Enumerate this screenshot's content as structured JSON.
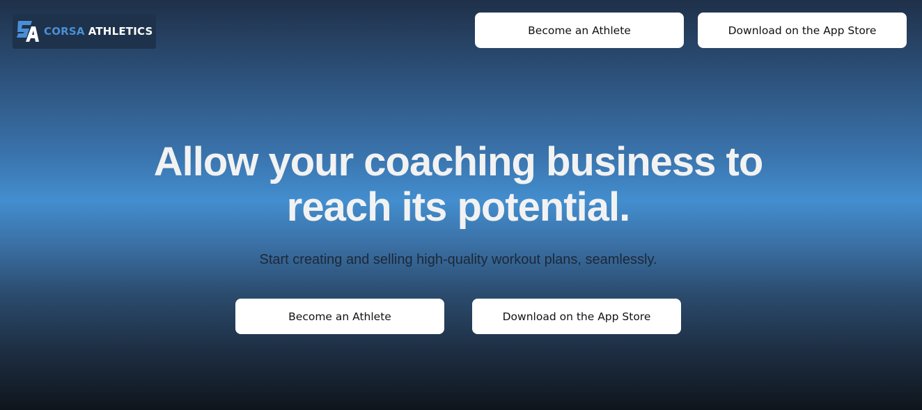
{
  "brand": {
    "word1": "CORSA",
    "word2": "ATHLETICS",
    "icon": "corsa-athletics-logo-icon",
    "colors": {
      "primary": "#4a8fd6",
      "secondary": "#ffffff",
      "badge_bg": "#1e324b"
    }
  },
  "nav": {
    "become_athlete_label": "Become an Athlete",
    "app_store_label": "Download on the App Store"
  },
  "hero": {
    "title_line1": "Allow your coaching business to",
    "title_line2": "reach its potential.",
    "subtitle": "Start creating and selling high-quality workout plans, seamlessly.",
    "become_athlete_label": "Become an Athlete",
    "app_store_label": "Download on the App Store"
  },
  "theme": {
    "gradient_top": "#1f3049",
    "gradient_mid": "#438ecf",
    "gradient_bottom": "#0f151c",
    "button_bg": "#ffffff",
    "button_text": "#111111",
    "title_color": "#f2f2f2",
    "subtitle_color": "#1b2838"
  }
}
